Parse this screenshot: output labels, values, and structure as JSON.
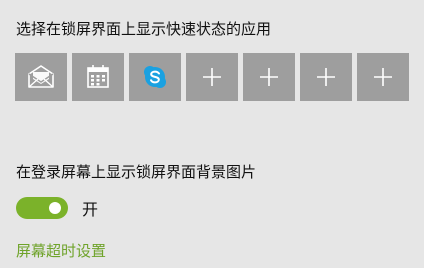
{
  "quick_status": {
    "title": "选择在锁屏界面上显示快速状态的应用",
    "tiles": [
      {
        "icon": "mail-icon",
        "kind": "app"
      },
      {
        "icon": "calendar-icon",
        "kind": "app"
      },
      {
        "icon": "skype-icon",
        "kind": "app"
      },
      {
        "icon": "plus-icon",
        "kind": "add"
      },
      {
        "icon": "plus-icon",
        "kind": "add"
      },
      {
        "icon": "plus-icon",
        "kind": "add"
      },
      {
        "icon": "plus-icon",
        "kind": "add"
      }
    ]
  },
  "signin_background": {
    "title": "在登录屏幕上显示锁屏界面背景图片",
    "toggle_on": true,
    "toggle_label": "开"
  },
  "screen_timeout_link": "屏幕超时设置",
  "colors": {
    "background": "#e6e6e6",
    "tile": "#9e9e9e",
    "accent": "#7bb22a",
    "link": "#6fa32a",
    "skype": "#1aa1e1"
  }
}
